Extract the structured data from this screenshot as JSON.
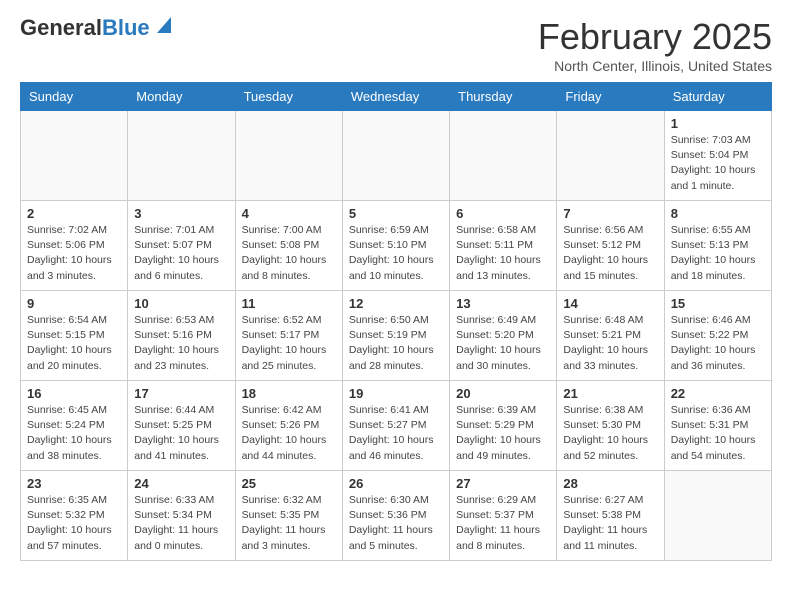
{
  "header": {
    "logo_general": "General",
    "logo_blue": "Blue",
    "month_title": "February 2025",
    "location": "North Center, Illinois, United States"
  },
  "days_of_week": [
    "Sunday",
    "Monday",
    "Tuesday",
    "Wednesday",
    "Thursday",
    "Friday",
    "Saturday"
  ],
  "weeks": [
    [
      {
        "day": "",
        "info": ""
      },
      {
        "day": "",
        "info": ""
      },
      {
        "day": "",
        "info": ""
      },
      {
        "day": "",
        "info": ""
      },
      {
        "day": "",
        "info": ""
      },
      {
        "day": "",
        "info": ""
      },
      {
        "day": "1",
        "info": "Sunrise: 7:03 AM\nSunset: 5:04 PM\nDaylight: 10 hours and 1 minute."
      }
    ],
    [
      {
        "day": "2",
        "info": "Sunrise: 7:02 AM\nSunset: 5:06 PM\nDaylight: 10 hours and 3 minutes."
      },
      {
        "day": "3",
        "info": "Sunrise: 7:01 AM\nSunset: 5:07 PM\nDaylight: 10 hours and 6 minutes."
      },
      {
        "day": "4",
        "info": "Sunrise: 7:00 AM\nSunset: 5:08 PM\nDaylight: 10 hours and 8 minutes."
      },
      {
        "day": "5",
        "info": "Sunrise: 6:59 AM\nSunset: 5:10 PM\nDaylight: 10 hours and 10 minutes."
      },
      {
        "day": "6",
        "info": "Sunrise: 6:58 AM\nSunset: 5:11 PM\nDaylight: 10 hours and 13 minutes."
      },
      {
        "day": "7",
        "info": "Sunrise: 6:56 AM\nSunset: 5:12 PM\nDaylight: 10 hours and 15 minutes."
      },
      {
        "day": "8",
        "info": "Sunrise: 6:55 AM\nSunset: 5:13 PM\nDaylight: 10 hours and 18 minutes."
      }
    ],
    [
      {
        "day": "9",
        "info": "Sunrise: 6:54 AM\nSunset: 5:15 PM\nDaylight: 10 hours and 20 minutes."
      },
      {
        "day": "10",
        "info": "Sunrise: 6:53 AM\nSunset: 5:16 PM\nDaylight: 10 hours and 23 minutes."
      },
      {
        "day": "11",
        "info": "Sunrise: 6:52 AM\nSunset: 5:17 PM\nDaylight: 10 hours and 25 minutes."
      },
      {
        "day": "12",
        "info": "Sunrise: 6:50 AM\nSunset: 5:19 PM\nDaylight: 10 hours and 28 minutes."
      },
      {
        "day": "13",
        "info": "Sunrise: 6:49 AM\nSunset: 5:20 PM\nDaylight: 10 hours and 30 minutes."
      },
      {
        "day": "14",
        "info": "Sunrise: 6:48 AM\nSunset: 5:21 PM\nDaylight: 10 hours and 33 minutes."
      },
      {
        "day": "15",
        "info": "Sunrise: 6:46 AM\nSunset: 5:22 PM\nDaylight: 10 hours and 36 minutes."
      }
    ],
    [
      {
        "day": "16",
        "info": "Sunrise: 6:45 AM\nSunset: 5:24 PM\nDaylight: 10 hours and 38 minutes."
      },
      {
        "day": "17",
        "info": "Sunrise: 6:44 AM\nSunset: 5:25 PM\nDaylight: 10 hours and 41 minutes."
      },
      {
        "day": "18",
        "info": "Sunrise: 6:42 AM\nSunset: 5:26 PM\nDaylight: 10 hours and 44 minutes."
      },
      {
        "day": "19",
        "info": "Sunrise: 6:41 AM\nSunset: 5:27 PM\nDaylight: 10 hours and 46 minutes."
      },
      {
        "day": "20",
        "info": "Sunrise: 6:39 AM\nSunset: 5:29 PM\nDaylight: 10 hours and 49 minutes."
      },
      {
        "day": "21",
        "info": "Sunrise: 6:38 AM\nSunset: 5:30 PM\nDaylight: 10 hours and 52 minutes."
      },
      {
        "day": "22",
        "info": "Sunrise: 6:36 AM\nSunset: 5:31 PM\nDaylight: 10 hours and 54 minutes."
      }
    ],
    [
      {
        "day": "23",
        "info": "Sunrise: 6:35 AM\nSunset: 5:32 PM\nDaylight: 10 hours and 57 minutes."
      },
      {
        "day": "24",
        "info": "Sunrise: 6:33 AM\nSunset: 5:34 PM\nDaylight: 11 hours and 0 minutes."
      },
      {
        "day": "25",
        "info": "Sunrise: 6:32 AM\nSunset: 5:35 PM\nDaylight: 11 hours and 3 minutes."
      },
      {
        "day": "26",
        "info": "Sunrise: 6:30 AM\nSunset: 5:36 PM\nDaylight: 11 hours and 5 minutes."
      },
      {
        "day": "27",
        "info": "Sunrise: 6:29 AM\nSunset: 5:37 PM\nDaylight: 11 hours and 8 minutes."
      },
      {
        "day": "28",
        "info": "Sunrise: 6:27 AM\nSunset: 5:38 PM\nDaylight: 11 hours and 11 minutes."
      },
      {
        "day": "",
        "info": ""
      }
    ]
  ]
}
